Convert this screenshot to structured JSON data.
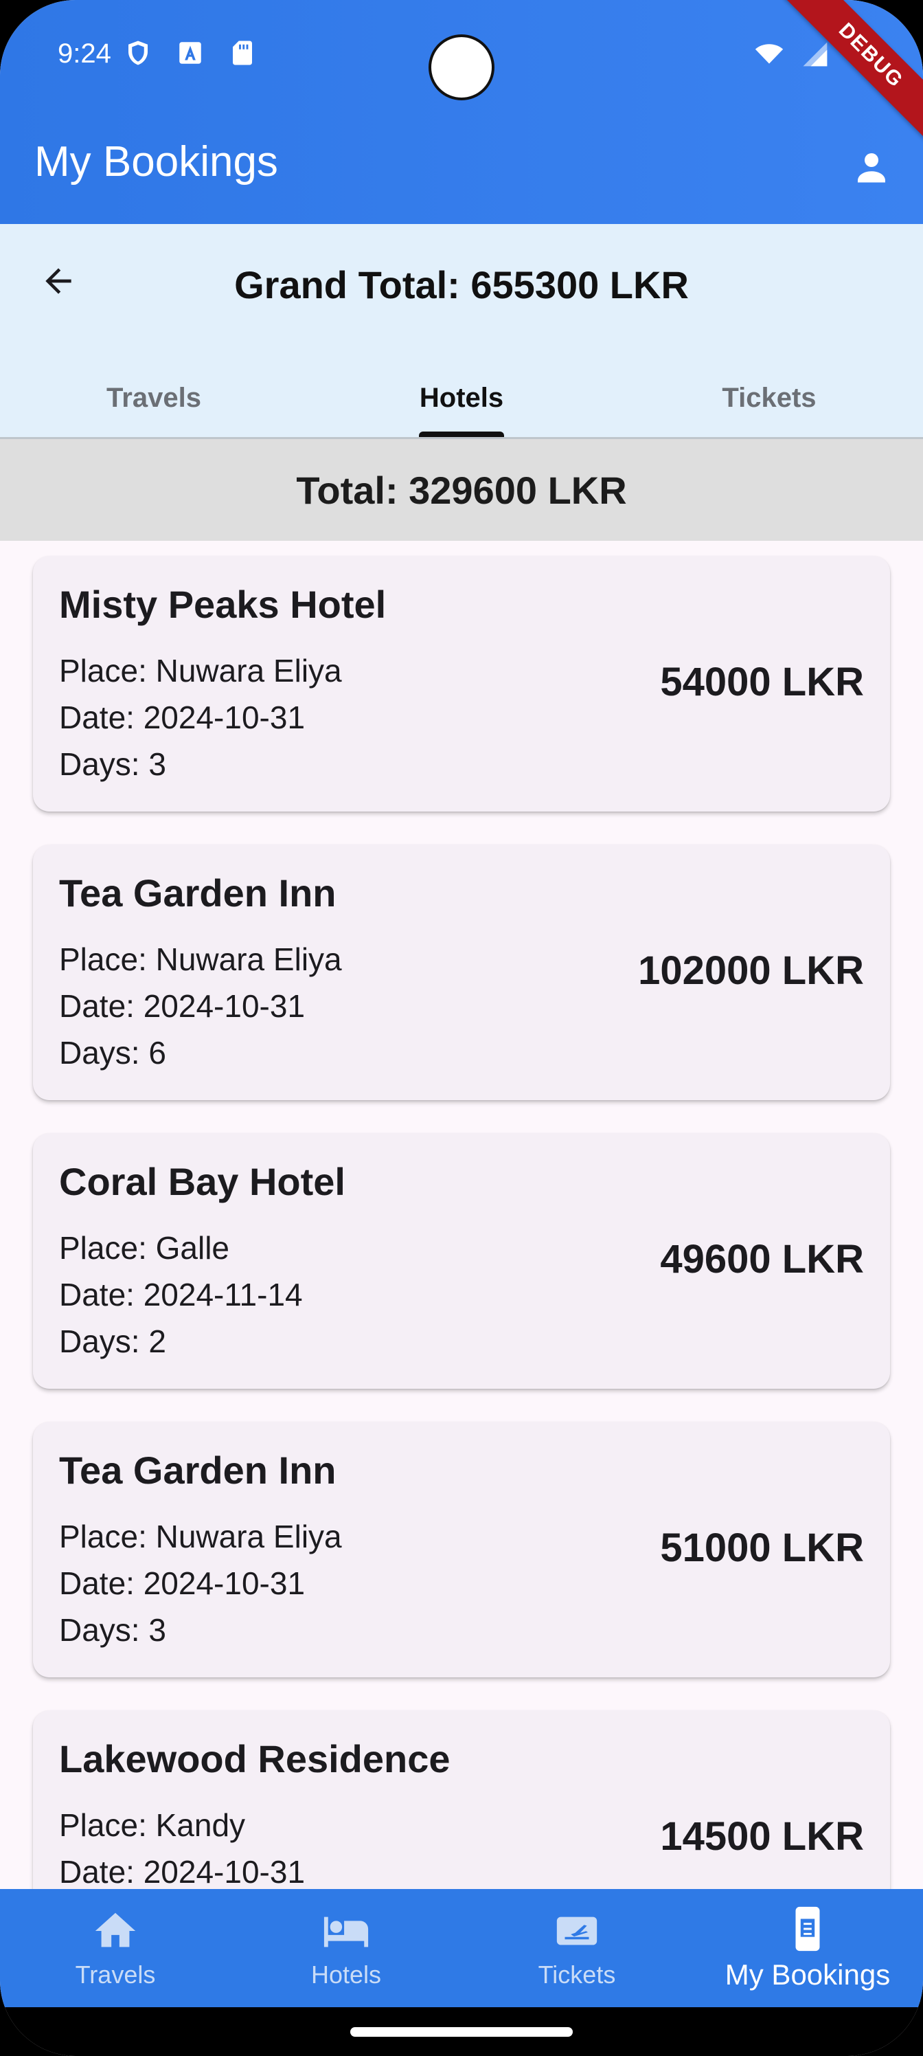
{
  "status_bar": {
    "time": "9:24"
  },
  "debug_label": "DEBUG",
  "app_bar": {
    "title": "My Bookings"
  },
  "header": {
    "grand_total": "Grand Total: 655300 LKR"
  },
  "tabs": [
    {
      "label": "Travels",
      "active": false
    },
    {
      "label": "Hotels",
      "active": true
    },
    {
      "label": "Tickets",
      "active": false
    }
  ],
  "section_total": "Total: 329600 LKR",
  "bookings": [
    {
      "name": "Misty Peaks Hotel",
      "place": "Place: Nuwara Eliya",
      "date": "Date: 2024-10-31",
      "days": "Days: 3",
      "price": "54000 LKR"
    },
    {
      "name": "Tea Garden Inn",
      "place": "Place: Nuwara Eliya",
      "date": "Date: 2024-10-31",
      "days": "Days: 6",
      "price": "102000 LKR"
    },
    {
      "name": "Coral Bay Hotel",
      "place": "Place: Galle",
      "date": "Date: 2024-11-14",
      "days": "Days: 2",
      "price": "49600 LKR"
    },
    {
      "name": "Tea Garden Inn",
      "place": "Place: Nuwara Eliya",
      "date": "Date: 2024-10-31",
      "days": "Days: 3",
      "price": "51000 LKR"
    },
    {
      "name": "Lakewood Residence",
      "place": "Place: Kandy",
      "date": "Date: 2024-10-31",
      "days": "",
      "price": "14500 LKR"
    }
  ],
  "bottom_nav": [
    {
      "label": "Travels",
      "icon": "home-icon",
      "active": false
    },
    {
      "label": "Hotels",
      "icon": "bed-icon",
      "active": false
    },
    {
      "label": "Tickets",
      "icon": "flight-ticket-icon",
      "active": false
    },
    {
      "label": "My Bookings",
      "icon": "booking-phone-icon",
      "active": true
    }
  ],
  "colors": {
    "primary": "#2f7ae6",
    "header_bg": "#e2f0fb",
    "card_bg": "#f5eff6",
    "total_bar_bg": "#dedede",
    "debug_ribbon": "#b3151c"
  }
}
